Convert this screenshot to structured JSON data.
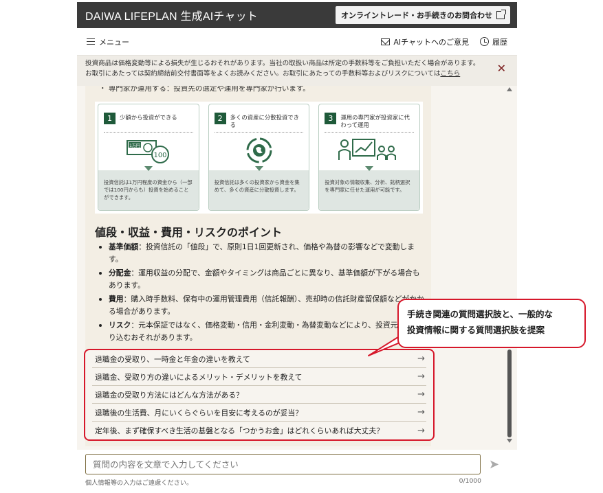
{
  "header": {
    "title": "DAIWA LIFEPLAN 生成AIチャット",
    "online_button": "オンライントレード・お手続きのお問合わせ"
  },
  "subbar": {
    "menu_label": "メニュー",
    "feedback_label": "AIチャットへのご意見",
    "history_label": "履歴"
  },
  "notice": {
    "line1": "投資商品は価格変動等による損失が生じるおそれがあります。当社の取扱い商品は所定の手数料等をご負担いただく場合があります。",
    "line2": "お取引にあたっては契約締結前交付書面等をよくお読みください。お取引にあたっての手数料等およびリスクについては",
    "link": "こちら"
  },
  "chat": {
    "cut_line": "・ 専門家が運用する：投資先の選定や運用を専門家が行います。",
    "cards": [
      {
        "num": "1",
        "title": "少額から投資ができる",
        "illus_label": "1万円",
        "illus_coin": "100",
        "desc": "投資信託は1万円程度の資金から（一部では100円からも）投資を始めることができます。"
      },
      {
        "num": "2",
        "title": "多くの資産に分散投資できる",
        "desc": "投資信託は多くの投資家から資金を集めて、多くの資産に分散投資します。"
      },
      {
        "num": "3",
        "title": "運用の専門家が投資家に代わって運用",
        "desc": "投資対象の情報収集、分析、銘柄選択を専門家に任せた運用が可能です。"
      }
    ],
    "section_title": "値段・収益・費用・リスクのポイント",
    "points": [
      {
        "term": "基準価額",
        "text": "：投資信託の「値段」で、原則1日1回更新され、価格や為替の影響などで変動します。"
      },
      {
        "term": "分配金",
        "text": "：運用収益の分配で、金額やタイミングは商品ごとに異なり、基準価額が下がる場合もあります。"
      },
      {
        "term": "費用",
        "text": "：購入時手数料、保有中の運用管理費用（信託報酬）、売却時の信託財産留保額などがかかる場合があります。"
      },
      {
        "term": "リスク",
        "text": "：元本保証ではなく、価格変動・信用・金利変動・為替変動などにより、投資元本を割り込むおそれがあります。"
      }
    ],
    "questions": [
      "退職金の受取り、一時金と年金の違いを教えて",
      "退職金、受取り方の違いによるメリット・デメリットを教えて",
      "退職金の受取り方法にはどんな方法がある？",
      "退職後の生活費、月にいくらぐらいを目安に考えるのが妥当？",
      "定年後、まず確保すべき生活の基盤となる「つかうお金」はどれくらいあれば大丈夫？"
    ],
    "arrow": "→"
  },
  "input": {
    "placeholder": "質問の内容を文章で入力してください",
    "hint": "個人情報等の入力はご遠慮ください。",
    "count": "0/1000"
  },
  "callout": {
    "line1": "手続き関連の質問選択肢と、一般的な",
    "line2": "投資情報に関する質問選択肢を提案"
  },
  "colors": {
    "accent_red": "#d6172a",
    "brand_green": "#1f5a3a",
    "header_dark": "#3a3a3a"
  }
}
